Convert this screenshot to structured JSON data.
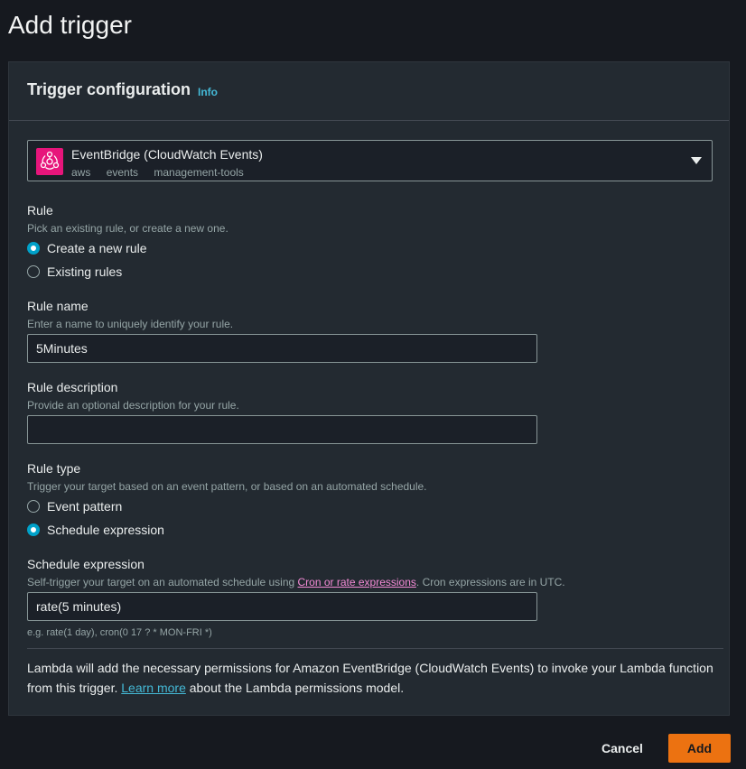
{
  "page_title": "Add trigger",
  "panel": {
    "title": "Trigger configuration",
    "info": "Info"
  },
  "source_select": {
    "name": "EventBridge (CloudWatch Events)",
    "tags": [
      "aws",
      "events",
      "management-tools"
    ],
    "icon": "eventbridge-icon",
    "icon_color": "#e7157b"
  },
  "rule": {
    "label": "Rule",
    "description": "Pick an existing rule, or create a new one.",
    "options": [
      "Create a new rule",
      "Existing rules"
    ],
    "selected": "Create a new rule"
  },
  "rule_name": {
    "label": "Rule name",
    "description": "Enter a name to uniquely identify your rule.",
    "value": "5Minutes"
  },
  "rule_description": {
    "label": "Rule description",
    "description": "Provide an optional description for your rule.",
    "value": ""
  },
  "rule_type": {
    "label": "Rule type",
    "description": "Trigger your target based on an event pattern, or based on an automated schedule.",
    "options": [
      "Event pattern",
      "Schedule expression"
    ],
    "selected": "Schedule expression"
  },
  "schedule_expression": {
    "label": "Schedule expression",
    "description_prefix": "Self-trigger your target on an automated schedule using ",
    "description_link": "Cron or rate expressions",
    "description_suffix": ". Cron expressions are in UTC.",
    "value": "rate(5 minutes)",
    "hint": "e.g. rate(1 day), cron(0 17 ? * MON-FRI *)"
  },
  "permissions_notice": {
    "prefix": "Lambda will add the necessary permissions for Amazon EventBridge (CloudWatch Events) to invoke your Lambda function from this trigger. ",
    "link": "Learn more",
    "suffix": " about the Lambda permissions model."
  },
  "footer": {
    "cancel_label": "Cancel",
    "add_label": "Add"
  },
  "colors": {
    "accent": "#00a1c9",
    "primary_button": "#ec7211",
    "link": "#44b9d6",
    "visited_link": "#f48bd6"
  }
}
